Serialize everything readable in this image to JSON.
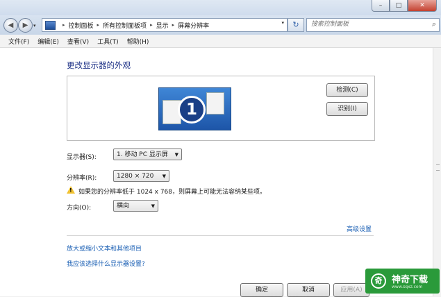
{
  "window": {
    "minimize": "–",
    "maximize": "□",
    "close": "✕"
  },
  "nav": {
    "back_glyph": "◀",
    "forward_glyph": "▶",
    "dropdown_glyph": "▾",
    "refresh_glyph": "↻"
  },
  "address": {
    "crumbs": [
      "控制面板",
      "所有控制面板项",
      "显示",
      "屏幕分辨率"
    ],
    "separator": "▸",
    "dropdown_glyph": "▾"
  },
  "search": {
    "placeholder": "搜索控制面板",
    "icon": "search-icon"
  },
  "menu": {
    "file": "文件(F)",
    "edit": "编辑(E)",
    "view": "查看(V)",
    "tools": "工具(T)",
    "help": "帮助(H)"
  },
  "main": {
    "heading": "更改显示器的外观",
    "monitor_number": "1",
    "detect_button": "检测(C)",
    "identify_button": "识别(I)",
    "display_label": "显示器(S):",
    "display_value": "1. 移动 PC 显示屏",
    "resolution_label": "分辨率(R):",
    "resolution_value": "1280 × 720",
    "warning": "如果您的分辨率低于 1024 x 768，则屏幕上可能无法容纳某些项。",
    "orientation_label": "方向(O):",
    "orientation_value": "横向",
    "advanced_link": "高级设置",
    "link_text_size": "放大或缩小文本和其他项目",
    "link_which_settings": "我应该选择什么显示器设置?",
    "combo_arrow": "▼",
    "warning_glyph": "!"
  },
  "footer": {
    "ok": "确定",
    "cancel": "取消",
    "apply": "应用(A)"
  },
  "logo": {
    "glyph": "奇",
    "title": "神奇下载",
    "url": "www.sqxz.com"
  },
  "colors": {
    "heading": "#1e3287",
    "link": "#1a5fb4",
    "logo_bg": "#2a9a3a"
  }
}
